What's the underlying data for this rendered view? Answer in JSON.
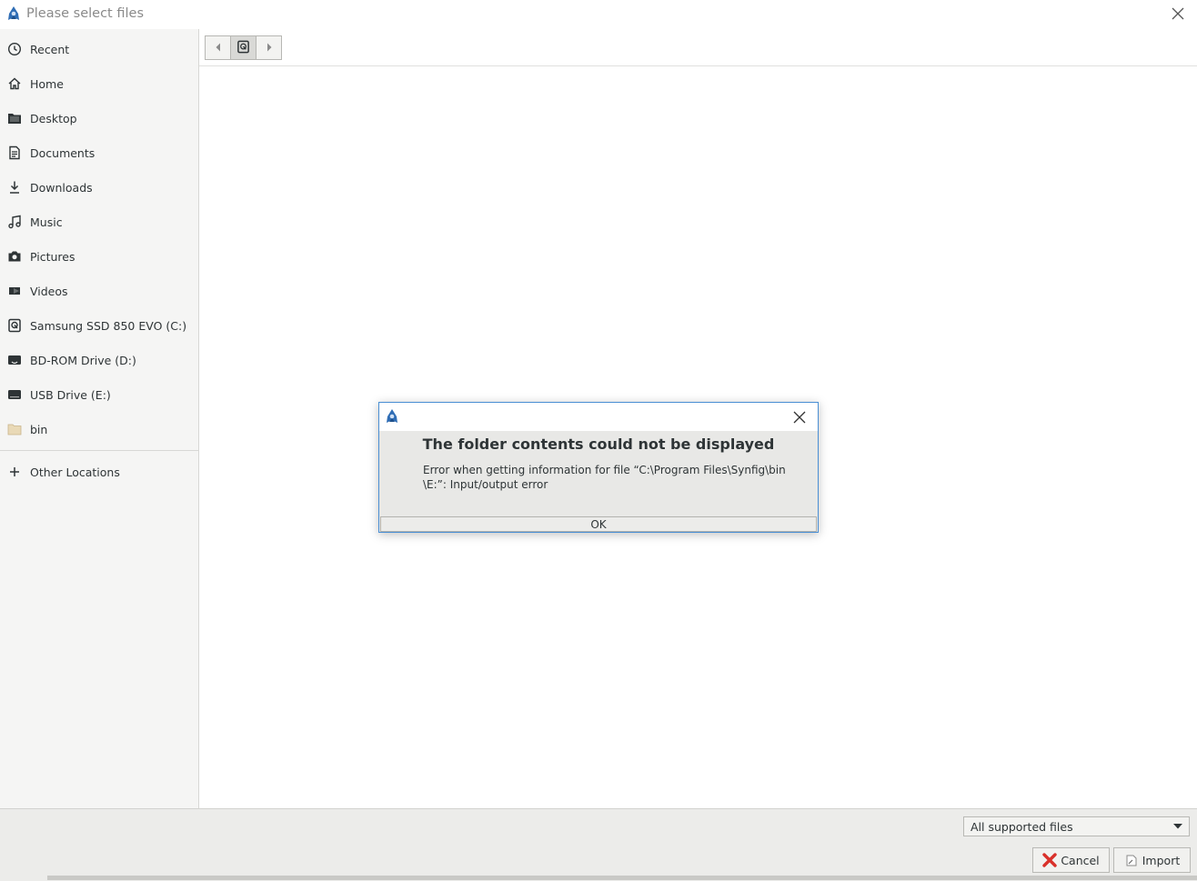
{
  "window": {
    "title": "Please select files",
    "app_icon": "synfig-logo-icon",
    "close_icon": "close-icon"
  },
  "sidebar": {
    "items": [
      {
        "label": "Recent",
        "icon": "clock-icon"
      },
      {
        "label": "Home",
        "icon": "home-icon"
      },
      {
        "label": "Desktop",
        "icon": "folder-icon"
      },
      {
        "label": "Documents",
        "icon": "document-icon"
      },
      {
        "label": "Downloads",
        "icon": "download-icon"
      },
      {
        "label": "Music",
        "icon": "music-icon"
      },
      {
        "label": "Pictures",
        "icon": "camera-icon"
      },
      {
        "label": "Videos",
        "icon": "video-icon"
      },
      {
        "label": "Samsung SSD 850 EVO (C:)",
        "icon": "hard-drive-icon"
      },
      {
        "label": "BD-ROM Drive (D:)",
        "icon": "optical-drive-icon"
      },
      {
        "label": "USB Drive (E:)",
        "icon": "usb-drive-icon"
      },
      {
        "label": "bin",
        "icon": "folder-icon"
      }
    ],
    "other": {
      "label": "Other Locations",
      "icon": "plus-icon"
    }
  },
  "pathbar": {
    "back_icon": "chevron-left-icon",
    "drive_icon": "drive-path-icon",
    "forward_icon": "chevron-right-icon"
  },
  "dialog": {
    "heading": "The folder contents could not be displayed",
    "message_line1": "Error when getting information for file “C:\\Program Files\\Synfig\\bin",
    "message_line2": "\\E:”: Input/output error",
    "ok_label": "OK"
  },
  "footer": {
    "filter_value": "All supported files",
    "cancel_label": "Cancel",
    "import_label": "Import"
  },
  "colors": {
    "dialog_border": "#4a8fd4",
    "sidebar_bg": "#f5f5f4",
    "cancel_icon_red": "#d9302a",
    "logo_blue": "#2f6db5"
  }
}
